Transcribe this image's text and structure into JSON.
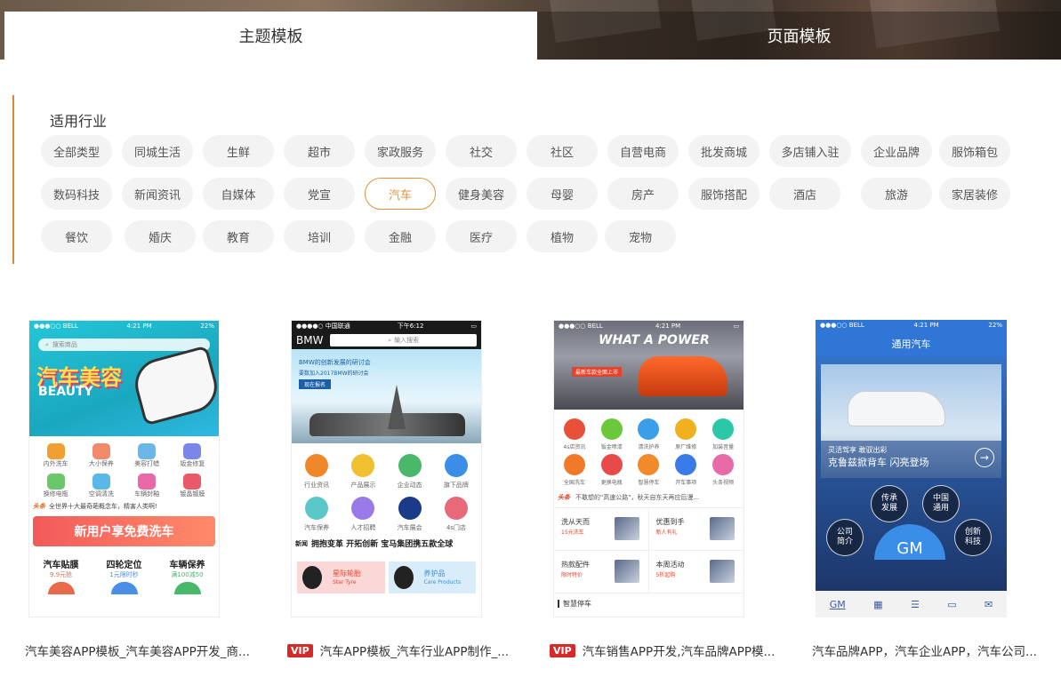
{
  "tabs": {
    "theme": "主题模板",
    "page": "页面模板"
  },
  "filter": {
    "title": "适用行业",
    "chips": [
      "全部类型",
      "同城生活",
      "生鲜",
      "超市",
      "家政服务",
      "社交",
      "社区",
      "自营电商",
      "批发商城",
      "多店铺入驻",
      "企业品牌",
      "服饰箱包",
      "数码科技",
      "新闻资讯",
      "自媒体",
      "党宣",
      "汽车",
      "健身美容",
      "母婴",
      "房产",
      "服饰搭配",
      "酒店",
      "旅游",
      "家居装修",
      "餐饮",
      "婚庆",
      "教育",
      "培训",
      "金融",
      "医疗",
      "植物",
      "宠物"
    ],
    "active": "汽车"
  },
  "cards": [
    {
      "caption": "汽车美容APP模板_汽车美容APP开发_商...",
      "vip": "",
      "status_left": "●●●○○ BELL",
      "status_time": "4:21 PM",
      "status_right": "22%",
      "search_placeholder": "搜索商品",
      "banner_title": "汽车美容",
      "banner_sub": "BEAUTY",
      "icons": [
        "内外洗车",
        "大小保养",
        "美容打蜡",
        "钣金修复",
        "换修电瓶",
        "空调清洗",
        "车辆封釉",
        "镀晶镀膜"
      ],
      "news_tag": "头条",
      "news_text": "全世界十大最奇葩概念车，精害人类啊!",
      "promo_text": "新用户享免费洗车",
      "services": [
        {
          "name": "汽车贴膜",
          "desc": "9.9元抢"
        },
        {
          "name": "四轮定位",
          "desc": "1元限时秒"
        },
        {
          "name": "车辆保养",
          "desc": "满100减50"
        }
      ]
    },
    {
      "caption": "汽车APP模板_汽车行业APP制作_...",
      "vip": "VIP",
      "status_left": "●●●●○ 中国联通",
      "status_time": "下午6:12",
      "status_right": "",
      "brand": "BMW",
      "search_placeholder": "输入搜索",
      "banner_title": "BMW的创新发展的研讨会",
      "banner_sub": "要数加入2017BMW的研讨会",
      "banner_btn": "现在报名",
      "icons": [
        "行业资讯",
        "产品展示",
        "企业动态",
        "旗下品牌",
        "汽车保养",
        "人才招聘",
        "汽车展会",
        "4s门店"
      ],
      "news_tag": "新闻",
      "news_text": "拥抱变革 开拓创新 宝马集团携五款全球",
      "products": [
        {
          "name": "星际轮胎",
          "sub": "Star Tyre"
        },
        {
          "name": "养护品",
          "sub": "Care Products"
        }
      ]
    },
    {
      "caption": "汽车销售APP开发,汽车品牌APP模...",
      "vip": "VIP",
      "status_left": "●●●○○ BELL",
      "status_time": "4:21 PM",
      "status_right": "",
      "banner_title": "WHAT A POWER",
      "banner_sub": "最新车款全面上市",
      "icons": [
        "4s店资讯",
        "钣金喷漆",
        "清洗护养",
        "原厂维修",
        "加装音量",
        "全国洗车",
        "更换电瓶",
        "智慧停车",
        "开车事项",
        "头条视频"
      ],
      "news_tag": "头条",
      "news_text": "不敢想的\"高速公路\"，秋天自东天再应后漫...",
      "deals": [
        {
          "title": "洗从天而",
          "sub": "15元洗车"
        },
        {
          "title": "优惠到手",
          "sub": "新人有礼"
        },
        {
          "title": "热款配件",
          "sub": "限时特价"
        },
        {
          "title": "本周活动",
          "sub": "5折起购"
        }
      ],
      "footer_label": "智慧停车"
    },
    {
      "caption": "汽车品牌APP，汽车企业APP，汽车公司...",
      "vip": "",
      "status_left": "●●●○○ BELL",
      "status_time": "4:21 PM",
      "status_right": "22%",
      "header_title": "通用汽车",
      "banner_title": "灵活驾享 敢驭出彩",
      "banner_sub": "克鲁兹掀背车 闪亮登场",
      "bubbles": [
        "传承发展",
        "中国通用",
        "公司简介",
        "创新科技"
      ],
      "logo": "GM",
      "nav_logo": "GM"
    }
  ]
}
